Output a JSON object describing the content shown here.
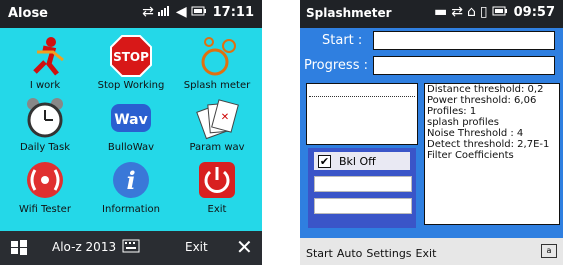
{
  "left_phone": {
    "title": "Alose",
    "time": "17:11",
    "apps": [
      {
        "label": "I work",
        "icon": "running-man-icon"
      },
      {
        "label": "Stop Working",
        "icon": "stop-sign-icon",
        "sign": "STOP"
      },
      {
        "label": "Splash meter",
        "icon": "bubbles-icon"
      },
      {
        "label": "Daily Task",
        "icon": "alarm-clock-icon"
      },
      {
        "label": "BulloWav",
        "icon": "wav-icon",
        "sign": "Wav"
      },
      {
        "label": "Param wav",
        "icon": "playing-cards-icon"
      },
      {
        "label": "Wifi Tester",
        "icon": "wifi-signal-icon"
      },
      {
        "label": "Information",
        "icon": "info-icon",
        "sign": "i"
      },
      {
        "label": "Exit",
        "icon": "power-icon"
      }
    ],
    "bottom": {
      "app_name": "Alo-z 2013",
      "exit_label": "Exit",
      "close_glyph": "✕"
    }
  },
  "right_phone": {
    "title": "Splashmeter",
    "time": "09:57",
    "start_label": "Start :",
    "start_value": "",
    "progress_label": "Progress :",
    "progress_value": "",
    "bkl_off": {
      "label": "Bkl Off",
      "checked": true
    },
    "info_lines": [
      "Distance threshold: 0,2",
      "Power threshold: 6,06",
      "Profiles: 1",
      "splash profiles",
      "Noise Threshold : 4",
      "Detect threshold: 2,7E-1",
      "Filter Coefficients"
    ],
    "menu": [
      "Start",
      "Auto",
      "Settings",
      "Exit"
    ]
  }
}
